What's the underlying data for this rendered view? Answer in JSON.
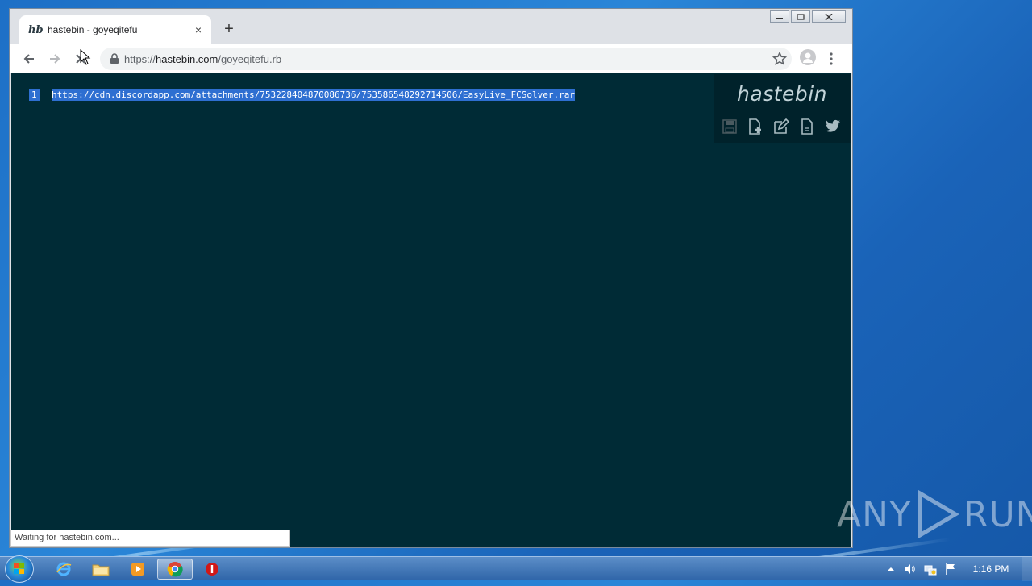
{
  "browser": {
    "tab": {
      "favicon": "hb",
      "title": "hastebin - goyeqitefu",
      "close": "×"
    },
    "new_tab": "+",
    "window_controls": {
      "minimize": "▁",
      "restore": "▭",
      "close": "✕"
    },
    "address": {
      "scheme": "https://",
      "host": "hastebin.com",
      "path": "/goyeqitefu.rb"
    },
    "status_text": "Waiting for hastebin.com..."
  },
  "page": {
    "logo": "hastebin",
    "line_number": "1",
    "code_line": "https://cdn.discordapp.com/attachments/753228404870086736/753586548292714506/EasyLive_FCSolver.rar",
    "tools": [
      "save-icon",
      "new-document-icon",
      "duplicate-edit-icon",
      "raw-text-icon",
      "twitter-icon"
    ]
  },
  "watermark": {
    "left": "ANY",
    "right": "RUN"
  },
  "taskbar": {
    "apps": [
      "internet-explorer-icon",
      "file-explorer-icon",
      "media-player-icon",
      "chrome-icon",
      "stop-icon"
    ],
    "clock": "1:16 PM"
  },
  "colors": {
    "editor_bg": "#002b36",
    "selection": "#2e6fd1",
    "chrome_frame": "#dee1e6"
  }
}
